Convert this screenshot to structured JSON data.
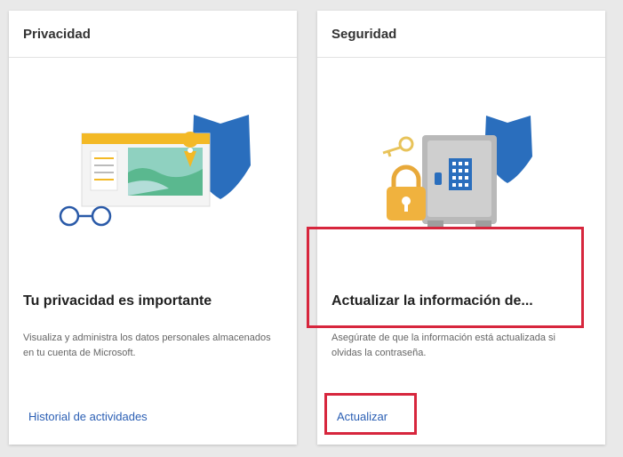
{
  "cards": [
    {
      "header": "Privacidad",
      "title": "Tu privacidad es importante",
      "description": "Visualiza y administra los datos personales almacenados en tu cuenta de Microsoft.",
      "link": "Historial de actividades",
      "illustration": "privacy-dashboard-illustration"
    },
    {
      "header": "Seguridad",
      "title": "Actualizar la información de...",
      "description": "Asegúrate de que la información está actualizada si olvidas la contraseña.",
      "link": "Actualizar",
      "illustration": "safe-lock-illustration"
    }
  ],
  "colors": {
    "link": "#2b5fb4",
    "highlight": "#d7263d",
    "shield": "#2a6ebd",
    "accent_yellow": "#f3b926"
  }
}
